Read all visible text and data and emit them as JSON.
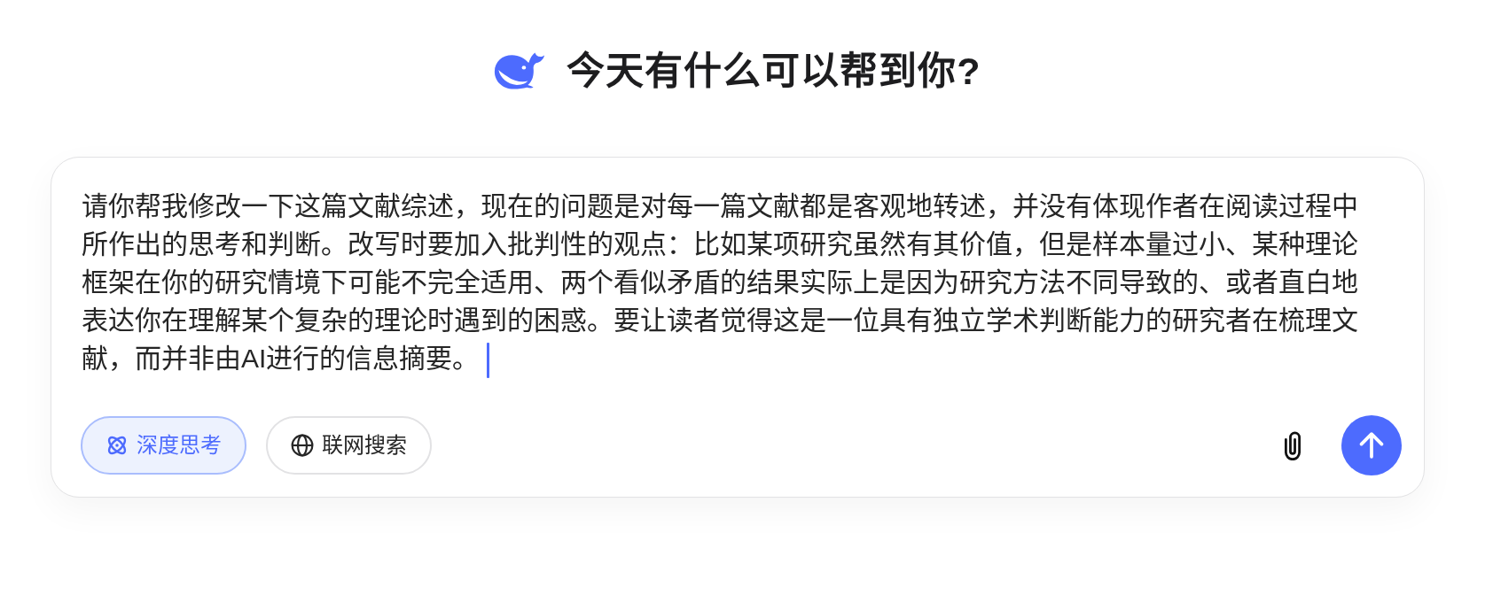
{
  "header": {
    "title": "今天有什么可以帮到你?"
  },
  "composer": {
    "message": "请你帮我修改一下这篇文献综述，现在的问题是对每一篇文献都是客观地转述，并没有体现作者在阅读过程中所作出的思考和判断。改写时要加入批判性的观点：比如某项研究虽然有其价值，但是样本量过小、某种理论框架在你的研究情境下可能不完全适用、两个看似矛盾的结果实际上是因为研究方法不同导致的、或者直白地表达你在理解某个复杂的理论时遇到的困惑。要让读者觉得这是一位具有独立学术判断能力的研究者在梳理文献，而并非由AI进行的信息摘要。",
    "focused": true
  },
  "toggles": [
    {
      "kind": "reasoning",
      "label": "深度思考",
      "on": true
    },
    {
      "kind": "search",
      "label": "联网搜索",
      "on": false
    }
  ]
}
